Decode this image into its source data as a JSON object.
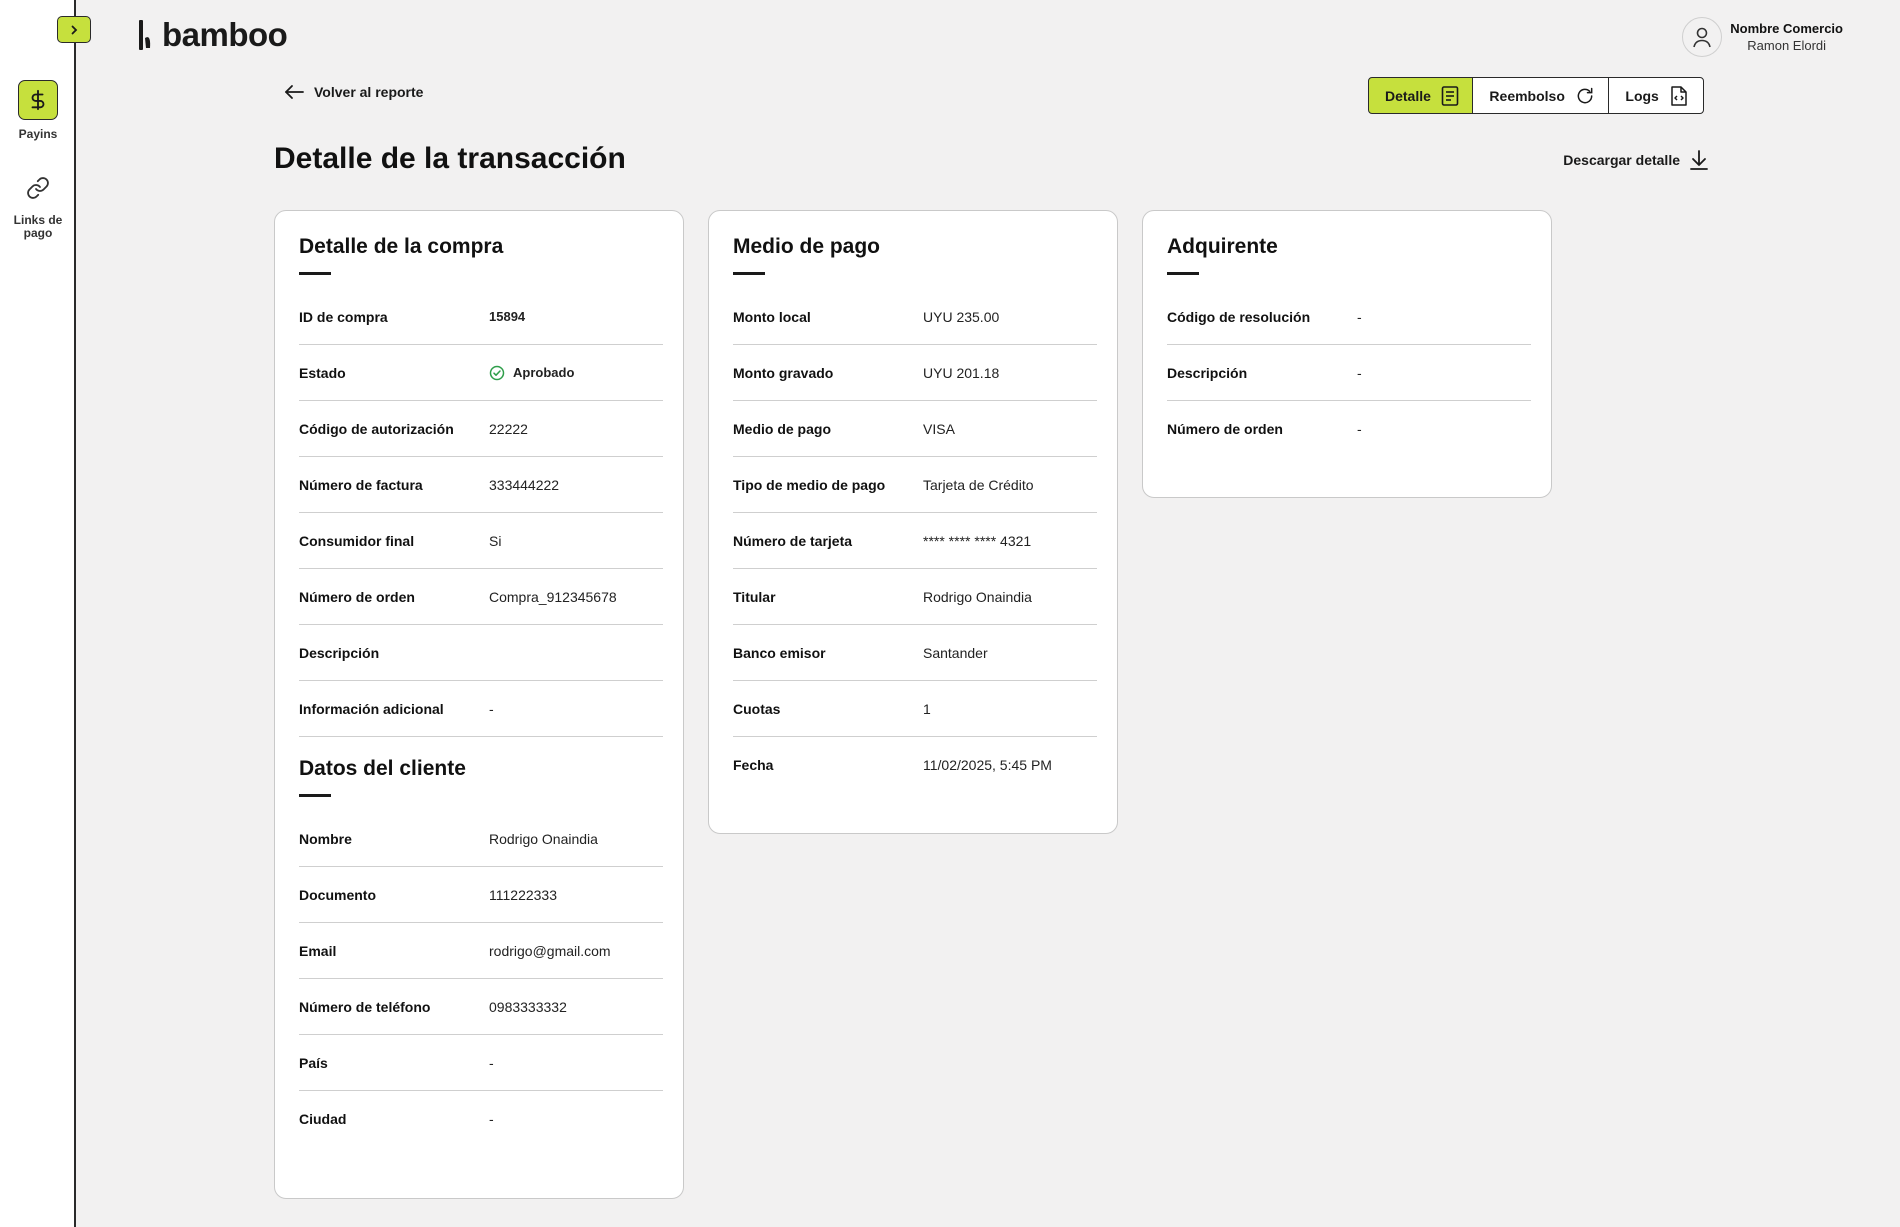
{
  "sidebar": {
    "items": [
      {
        "label": "Payins",
        "icon": "dollar-icon",
        "active": true
      },
      {
        "label": "Links de pago",
        "icon": "link-icon",
        "active": false
      }
    ]
  },
  "brand": {
    "name": "bamboo",
    "accent": "#c6e03d"
  },
  "user": {
    "name": "Nombre Comercio",
    "subtitle": "Ramon Elordi"
  },
  "nav": {
    "back_label": "Volver al reporte"
  },
  "tabs": [
    {
      "label": "Detalle",
      "icon": "document-icon",
      "active": true
    },
    {
      "label": "Reembolso",
      "icon": "refresh-icon",
      "active": false
    },
    {
      "label": "Logs",
      "icon": "code-file-icon",
      "active": false
    }
  ],
  "page": {
    "title": "Detalle de la transacción",
    "download_label": "Descargar detalle"
  },
  "purchase": {
    "title": "Detalle de la compra",
    "rows": [
      {
        "label": "ID de compra",
        "value": "15894"
      },
      {
        "label": "Estado",
        "value": "Aprobado"
      },
      {
        "label": "Código de autorización",
        "value": "22222"
      },
      {
        "label": "Número de factura",
        "value": "333444222"
      },
      {
        "label": "Consumidor final",
        "value": "Si"
      },
      {
        "label": "Número de orden",
        "value": "Compra_912345678"
      },
      {
        "label": "Descripción",
        "value": ""
      },
      {
        "label": "Información adicional",
        "value": "-"
      }
    ]
  },
  "client": {
    "title": "Datos del cliente",
    "rows": [
      {
        "label": "Nombre",
        "value": "Rodrigo Onaindia"
      },
      {
        "label": "Documento",
        "value": "111222333"
      },
      {
        "label": "Email",
        "value": "rodrigo@gmail.com"
      },
      {
        "label": "Número de teléfono",
        "value": "0983333332"
      },
      {
        "label": "País",
        "value": "-"
      },
      {
        "label": "Ciudad",
        "value": "-"
      }
    ]
  },
  "payment": {
    "title": "Medio de pago",
    "rows": [
      {
        "label": "Monto local",
        "value": "UYU 235.00"
      },
      {
        "label": "Monto gravado",
        "value": "UYU 201.18"
      },
      {
        "label": "Medio de pago",
        "value": "VISA"
      },
      {
        "label": "Tipo de medio de pago",
        "value": "Tarjeta de Crédito"
      },
      {
        "label": "Número de tarjeta",
        "value": "**** **** **** 4321"
      },
      {
        "label": "Titular",
        "value": "Rodrigo Onaindia"
      },
      {
        "label": "Banco emisor",
        "value": "Santander"
      },
      {
        "label": "Cuotas",
        "value": "1"
      },
      {
        "label": "Fecha",
        "value": "11/02/2025, 5:45 PM"
      }
    ]
  },
  "acquirer": {
    "title": "Adquirente",
    "rows": [
      {
        "label": "Código de resolución",
        "value": "-"
      },
      {
        "label": "Descripción",
        "value": "-"
      },
      {
        "label": "Número de orden",
        "value": "-"
      }
    ]
  },
  "colors": {
    "accent": "#c6e03d",
    "success": "#2e9e4a",
    "border": "#2a2a2a"
  }
}
